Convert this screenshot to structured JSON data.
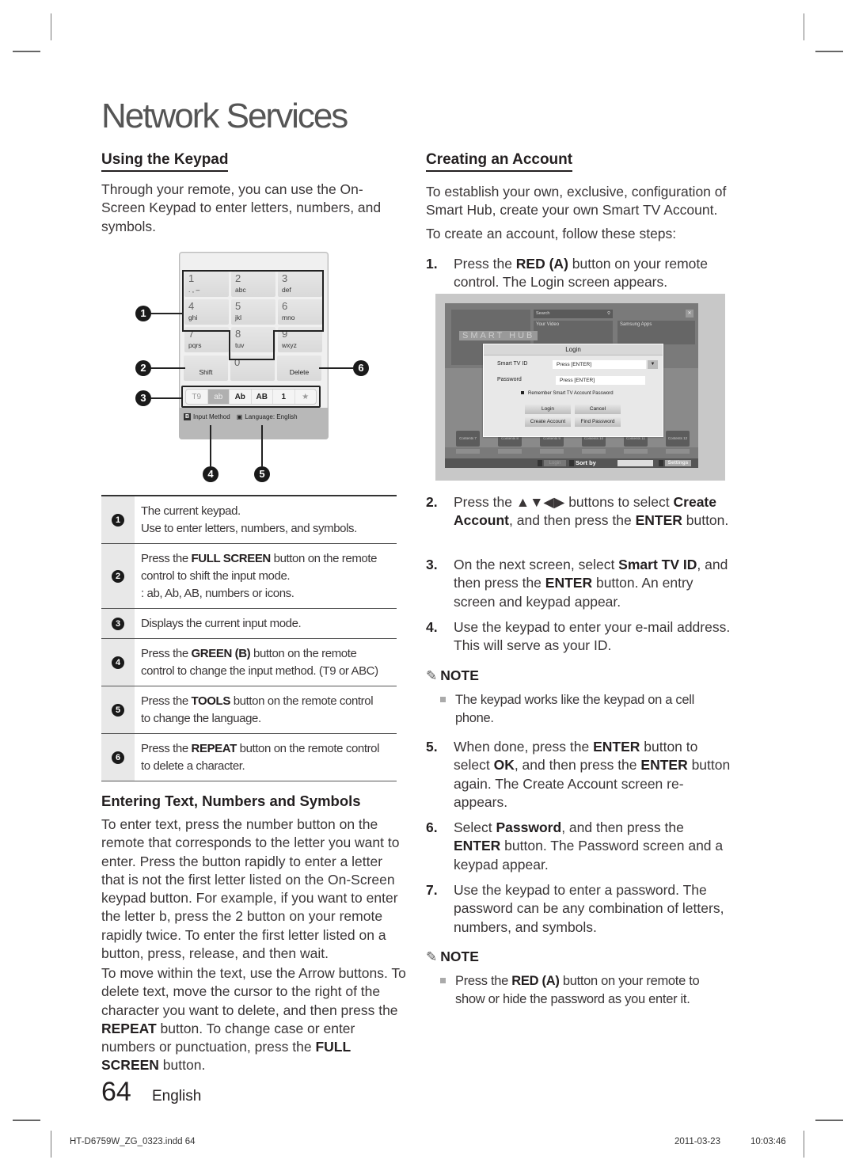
{
  "page": {
    "title": "Network Services",
    "page_number": "64",
    "language": "English"
  },
  "left": {
    "keypad_heading": "Using the Keypad",
    "keypad_intro": "Through your remote, you can use the On-Screen Keypad to enter letters, numbers, and symbols.",
    "keypad_figure": {
      "keys": [
        {
          "num": "1",
          "letters": ". , –"
        },
        {
          "num": "2",
          "letters": "abc"
        },
        {
          "num": "3",
          "letters": "def"
        },
        {
          "num": "4",
          "letters": "ghi"
        },
        {
          "num": "5",
          "letters": "jkl"
        },
        {
          "num": "6",
          "letters": "mno"
        },
        {
          "num": "7",
          "letters": "pqrs"
        },
        {
          "num": "8",
          "letters": "tuv"
        },
        {
          "num": "9",
          "letters": "wxyz"
        }
      ],
      "zero": "0",
      "shift": "Shift",
      "delete": "Delete",
      "modes": [
        "T9",
        "ab",
        "Ab",
        "AB",
        "1",
        "★"
      ],
      "active_mode": "ab",
      "input_method_key": "B",
      "input_method": "Input Method",
      "language_label": "Language: English",
      "callouts": [
        "1",
        "2",
        "3",
        "4",
        "5",
        "6"
      ]
    },
    "legend": [
      {
        "num": "1",
        "lines": [
          {
            "pre": "The current keypad.",
            "bold": "",
            "post": ""
          },
          {
            "pre": "Use to enter letters, numbers, and symbols.",
            "bold": "",
            "post": ""
          }
        ]
      },
      {
        "num": "2",
        "lines": [
          {
            "pre": "Press the ",
            "bold": "FULL SCREEN",
            "post": " button on the remote"
          },
          {
            "pre": "control to shift the input mode.",
            "bold": "",
            "post": ""
          },
          {
            "pre": ": ab, Ab, AB, numbers or icons.",
            "bold": "",
            "post": ""
          }
        ]
      },
      {
        "num": "3",
        "lines": [
          {
            "pre": "Displays the current input mode.",
            "bold": "",
            "post": ""
          }
        ]
      },
      {
        "num": "4",
        "lines": [
          {
            "pre": "Press the ",
            "bold": "GREEN (B)",
            "post": " button on the remote"
          },
          {
            "pre": "control to change the input method. (T9 or ABC)",
            "bold": "",
            "post": ""
          }
        ]
      },
      {
        "num": "5",
        "lines": [
          {
            "pre": "Press the ",
            "bold": "TOOLS",
            "post": " button on the remote control"
          },
          {
            "pre": "to change the language.",
            "bold": "",
            "post": ""
          }
        ]
      },
      {
        "num": "6",
        "lines": [
          {
            "pre": "Press the ",
            "bold": "REPEAT",
            "post": " button on the remote control"
          },
          {
            "pre": "to delete a character.",
            "bold": "",
            "post": ""
          }
        ]
      }
    ],
    "entering_heading": "Entering Text, Numbers and Symbols",
    "entering_p1": "To enter text, press the number button on the remote that corresponds to the letter you want to enter. Press the button rapidly to enter a letter that is not the first letter listed on the On-Screen keypad button. For example, if you want to enter the letter b, press the 2 button on your remote rapidly twice. To enter the first letter listed on a button, press, release, and then wait.",
    "entering_p2": {
      "a": "To move within the text, use the Arrow buttons. To delete text, move the cursor to the right of the character you want to delete, and then press the ",
      "b1": "REPEAT",
      "c": " button. To change case or enter numbers or punctuation, press the ",
      "b2": "FULL SCREEN",
      "d": " button."
    }
  },
  "right": {
    "heading": "Creating an Account",
    "intro1": "To establish your own, exclusive, configuration of Smart Hub, create your own Smart TV Account.",
    "intro2": "To create an account, follow these steps:",
    "steps": [
      {
        "n": "1.",
        "parts": [
          {
            "t": "Press the "
          },
          {
            "b": "RED (A)"
          },
          {
            "t": " button on your remote control. The Login screen appears."
          }
        ]
      },
      {
        "n": "2.",
        "parts": [
          {
            "t": "Press the ▲▼◀▶ buttons to select "
          },
          {
            "b": "Create Account"
          },
          {
            "t": ", and then press the "
          },
          {
            "b": "ENTER"
          },
          {
            "t": " button."
          }
        ]
      },
      {
        "n": "3.",
        "parts": [
          {
            "t": "On the next screen, select "
          },
          {
            "b": "Smart TV ID"
          },
          {
            "t": ", and then press the "
          },
          {
            "b": "ENTER"
          },
          {
            "t": " button. An entry screen and keypad appear."
          }
        ]
      },
      {
        "n": "4.",
        "parts": [
          {
            "t": "Use the keypad to enter your e-mail address. This will serve as your ID."
          }
        ]
      },
      {
        "n": "5.",
        "parts": [
          {
            "t": "When done, press the "
          },
          {
            "b": "ENTER"
          },
          {
            "t": " button to select "
          },
          {
            "b": "OK"
          },
          {
            "t": ", and then press the "
          },
          {
            "b": "ENTER"
          },
          {
            "t": " button again. The Create Account screen re-appears."
          }
        ]
      },
      {
        "n": "6.",
        "parts": [
          {
            "t": "Select "
          },
          {
            "b": "Password"
          },
          {
            "t": ", and then press the "
          },
          {
            "b": "ENTER"
          },
          {
            "t": " button. The Password screen and a keypad appear."
          }
        ]
      },
      {
        "n": "7.",
        "parts": [
          {
            "t": "Use the keypad to enter a password. The password can be any combination of letters, numbers, and symbols."
          }
        ]
      }
    ],
    "note_label": "NOTE",
    "note1": "The keypad works like the keypad on a cell phone.",
    "note2": {
      "a": "Press the ",
      "b": "RED (A)",
      "c": " button on your remote to show or hide the password as you enter it."
    },
    "login_screen": {
      "search": "Search",
      "your_video": "Your Video",
      "samsung_apps": "Samsung Apps",
      "smart_hub_logo": "SMART HUB",
      "dialog_title": "Login",
      "id_label": "Smart TV ID",
      "id_value": "Press [ENTER]",
      "password_label": "Password",
      "password_value": "Press [ENTER]",
      "remember": "Remember Smart TV Account Password",
      "buttons": [
        "Login",
        "Cancel",
        "Create Account",
        "Find Password"
      ],
      "bottom_bar": {
        "a": "Login",
        "b": "Sort by",
        "d": "Settings"
      },
      "content_tiles": [
        "Contents 7",
        "Contents 8",
        "Contents 9",
        "Contents 10",
        "Contents 11",
        "Contents 12"
      ]
    }
  },
  "footer": {
    "file": "HT-D6759W_ZG_0323.indd   64",
    "date": "2011-03-23",
    "time": "10:03:46"
  }
}
